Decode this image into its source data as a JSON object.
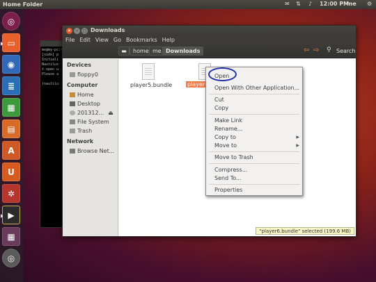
{
  "panel": {
    "title": "Home Folder",
    "clock": "12:00 PM",
    "user": "me"
  },
  "window": {
    "title": "Downloads",
    "menu": [
      "File",
      "Edit",
      "View",
      "Go",
      "Bookmarks",
      "Help"
    ],
    "breadcrumbs": [
      "home",
      "me",
      "Downloads"
    ],
    "search_label": "Search"
  },
  "sidebar": {
    "devices_header": "Devices",
    "devices": [
      "floppy0"
    ],
    "computer_header": "Computer",
    "computer": [
      "Home",
      "Desktop",
      "201312...",
      "File System",
      "Trash"
    ],
    "network_header": "Network",
    "network": [
      "Browse Net..."
    ]
  },
  "files": [
    {
      "name": "player5.bundle",
      "selected": false
    },
    {
      "name": "player6",
      "selected": true
    }
  ],
  "context_menu": {
    "open": "Open",
    "open_with": "Open With Other Application...",
    "cut": "Cut",
    "copy": "Copy",
    "make_link": "Make Link",
    "rename": "Rename...",
    "copy_to": "Copy to",
    "move_to": "Move to",
    "move_to_trash": "Move to Trash",
    "compress": "Compress...",
    "send_to": "Send To...",
    "properties": "Properties"
  },
  "status": "\"player6.bundle\" selected (199.6 MB)",
  "terminal_lines": [
    "me@my-pc:~",
    "[sudo] p",
    "Initiali",
    "Nautilus",
    "t open u",
    "Please a",
    "",
    "(nautilu"
  ],
  "launcher_icons": [
    "dash-icon",
    "files-icon",
    "firefox-icon",
    "writer-icon",
    "calc-icon",
    "impress-icon",
    "software-center-icon",
    "ubuntu-one-icon",
    "settings-icon",
    "terminal-icon",
    "workspaces-icon",
    "dvd-icon"
  ],
  "colors": {
    "accent": "#e95420",
    "selection": "#f07746",
    "panel": "#3c3b37"
  }
}
